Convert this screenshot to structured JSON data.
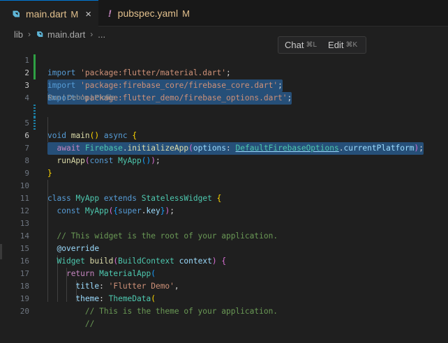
{
  "tabs": [
    {
      "name": "main.dart",
      "status": "M",
      "active": true,
      "icon": "dart-icon"
    },
    {
      "name": "pubspec.yaml",
      "status": "M",
      "active": false,
      "icon": "exclamation-icon"
    }
  ],
  "tab_close_glyph": "×",
  "breadcrumb": {
    "folder": "lib",
    "file": "main.dart",
    "more": "..."
  },
  "codelens": "Run | Debug | Profile",
  "chat_bar": {
    "chat_label": "Chat",
    "chat_kbd": "⌘L",
    "edit_label": "Edit",
    "edit_kbd": "⌘K"
  },
  "line_numbers": [
    "1",
    "2",
    "3",
    "4",
    "5",
    "6",
    "7",
    "8",
    "9",
    "10",
    "11",
    "12",
    "13",
    "14",
    "15",
    "16",
    "17",
    "18",
    "19",
    "20"
  ],
  "code": {
    "l1": {
      "kw": "import",
      "str": "'package:flutter/material.dart'",
      "end": ";"
    },
    "l2": {
      "kw": "import",
      "str": "'package:firebase_core/firebase_core.dart'",
      "end": ";"
    },
    "l3": {
      "kw": "import",
      "str": "'package:flutter_demo/firebase_options.dart'",
      "end": ";"
    },
    "l5": {
      "type": "void",
      "fn": "main",
      "paren": "()",
      "kw": "async",
      "brace": "{"
    },
    "l6": {
      "kw": "await",
      "cls": "Firebase",
      "dot": ".",
      "fn": "initializeApp",
      "open": "(",
      "param": "options",
      "colon": ":",
      "opt": "DefaultFirebaseOptions",
      "dot2": ".",
      "prop": "currentPlatform",
      "close": ")",
      "end": ";"
    },
    "l7": {
      "fn": "runApp",
      "open": "(",
      "kw": "const",
      "cls": "MyApp",
      "inner": "()",
      "close": ")",
      "end": ";"
    },
    "l8": {
      "brace": "}"
    },
    "l10": {
      "kw": "class",
      "cls": "MyApp",
      "kw2": "extends",
      "cls2": "StatelessWidget",
      "brace": "{"
    },
    "l11": {
      "kw": "const",
      "cls": "MyApp",
      "open": "(",
      "brace": "{",
      "kw2": "super",
      "dot": ".",
      "prop": "key",
      "brace2": "}",
      "close": ")",
      "end": ";"
    },
    "l13": {
      "comment": "// This widget is the root of your application."
    },
    "l14": {
      "annot": "@override"
    },
    "l15": {
      "cls": "Widget",
      "fn": "build",
      "open": "(",
      "cls2": "BuildContext",
      "param": "context",
      "close": ")",
      "brace": "{"
    },
    "l16": {
      "kw": "return",
      "cls": "MaterialApp",
      "open": "("
    },
    "l17": {
      "prop": "title",
      "colon": ":",
      "str": "'Flutter Demo'",
      "end": ","
    },
    "l18": {
      "prop": "theme",
      "colon": ":",
      "cls": "ThemeData",
      "open": "("
    },
    "l19": {
      "comment": "// This is the theme of your application."
    },
    "l20": {
      "comment": "//"
    }
  },
  "colors": {
    "accent": "#0078d4",
    "added": "#2ea043",
    "modified": "#1b81a8",
    "selection": "#264f78",
    "git_modified": "#e2c08d"
  }
}
